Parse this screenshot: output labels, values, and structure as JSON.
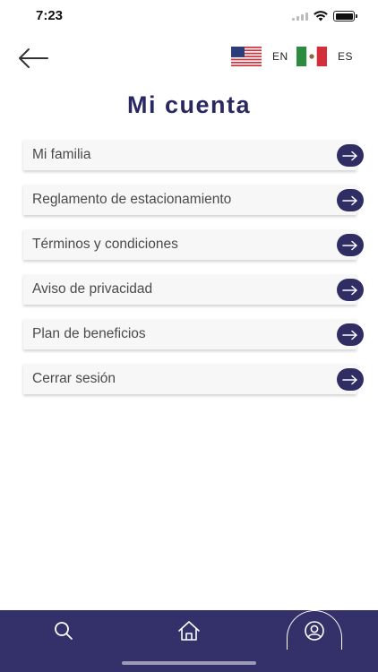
{
  "status_bar": {
    "time": "7:23",
    "icons": [
      "signal-icon",
      "wifi-icon",
      "battery-icon"
    ]
  },
  "header": {
    "back_icon": "arrow-left-icon",
    "languages": [
      {
        "code": "EN",
        "flag": "us-flag-icon"
      },
      {
        "code": "ES",
        "flag": "mexico-flag-icon"
      }
    ]
  },
  "page": {
    "title": "Mi cuenta"
  },
  "menu": {
    "items": [
      {
        "label": "Mi familia",
        "icon": "arrow-right-icon"
      },
      {
        "label": "Reglamento de estacionamiento",
        "icon": "arrow-right-icon"
      },
      {
        "label": "Términos y condiciones",
        "icon": "arrow-right-icon"
      },
      {
        "label": "Aviso de privacidad",
        "icon": "arrow-right-icon"
      },
      {
        "label": "Plan de beneficios",
        "icon": "arrow-right-icon"
      },
      {
        "label": "Cerrar sesión",
        "icon": "arrow-right-icon"
      }
    ]
  },
  "tab_bar": {
    "tabs": [
      {
        "icon": "search-icon",
        "active": false
      },
      {
        "icon": "home-icon",
        "active": false
      },
      {
        "icon": "user-circle-icon",
        "active": true
      }
    ]
  },
  "colors": {
    "primary": "#2f2d63",
    "title": "#2a2860",
    "tab_bar": "#33306a",
    "item_bg": "#f7f7f8"
  }
}
